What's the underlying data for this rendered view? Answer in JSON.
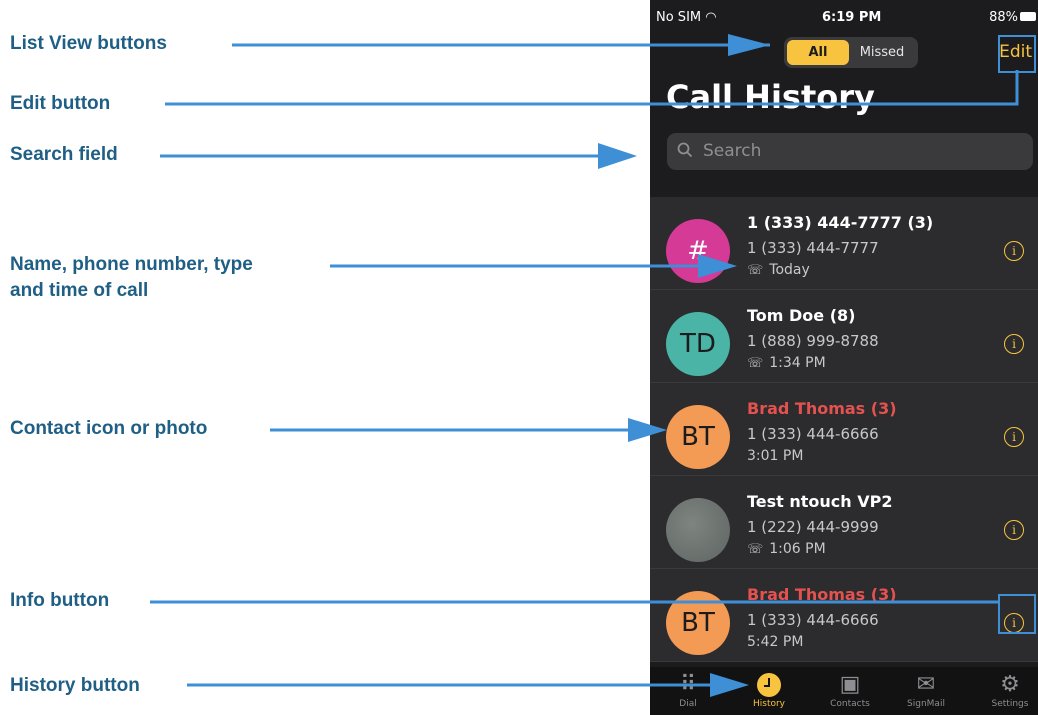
{
  "callouts": {
    "list_view": "List View buttons",
    "edit": "Edit button",
    "search": "Search field",
    "name_line1": "Name, phone number, type",
    "name_line2": "and time of call",
    "contact_icon": "Contact icon or photo",
    "info": "Info button",
    "history": "History button"
  },
  "status": {
    "carrier": "No SIM",
    "time": "6:19 PM",
    "battery": "88%"
  },
  "segment": {
    "all": "All",
    "missed": "Missed"
  },
  "edit_label": "Edit",
  "title": "Call History",
  "search": {
    "placeholder": "Search"
  },
  "calls": [
    {
      "initials": "#",
      "name": "1 (333) 444-7777 (3)",
      "number": "1 (333) 444-7777",
      "when": "Today",
      "missed": false,
      "call_icon": "phone-outgoing-icon",
      "avatar_color": "#d43a96"
    },
    {
      "initials": "TD",
      "name": "Tom Doe (8)",
      "number": "1 (888) 999-8788",
      "when": "1:34 PM",
      "missed": false,
      "call_icon": "phone-outgoing-icon",
      "avatar_color": "#4ab5a6"
    },
    {
      "initials": "BT",
      "name": "Brad Thomas (3)",
      "number": "1 (333) 444-6666",
      "when": "3:01 PM",
      "missed": true,
      "avatar_color": "#f39a55"
    },
    {
      "initials": "",
      "name": "Test ntouch VP2",
      "number": "1 (222) 444-9999",
      "when": "1:06 PM",
      "missed": false,
      "call_icon": "phone-outgoing-icon",
      "avatar_color": "#6e7571"
    },
    {
      "initials": "BT",
      "name": "Brad Thomas (3)",
      "number": "1 (333) 444-6666",
      "when": "5:42 PM",
      "missed": true,
      "avatar_color": "#f39a55"
    }
  ],
  "tabs": [
    {
      "label": "Dial",
      "icon": "dialpad-icon"
    },
    {
      "label": "History",
      "icon": "clock-icon",
      "active": true
    },
    {
      "label": "Contacts",
      "icon": "contacts-icon"
    },
    {
      "label": "SignMail",
      "icon": "mail-icon"
    },
    {
      "label": "Settings",
      "icon": "gear-icon"
    }
  ],
  "colors": {
    "accent": "#f8c33f",
    "missed": "#e4524f",
    "callout_text": "#1f5f86",
    "arrow": "#3e8fd6"
  }
}
